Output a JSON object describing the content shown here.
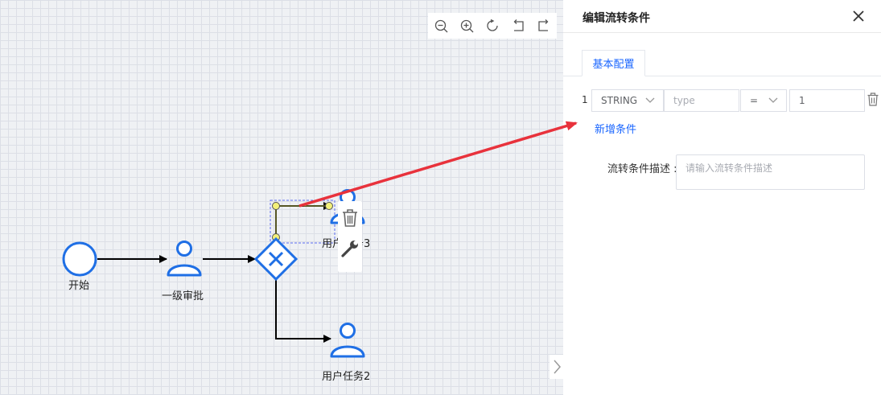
{
  "toolbar": {
    "items": [
      "zoom-out",
      "zoom-in",
      "reset",
      "undo",
      "redo"
    ]
  },
  "nodes": {
    "start_label": "开始",
    "approval_label": "一级审批",
    "task3_label": "用户任务3",
    "task2_label": "用户任务2"
  },
  "panel": {
    "title": "编辑流转条件",
    "tab_basic": "基本配置",
    "condition": {
      "index": "1",
      "type_value": "STRING",
      "field_placeholder": "type",
      "operator_value": "=",
      "compare_value": "1"
    },
    "add_condition": "新增条件",
    "description_label": "流转条件描述 :",
    "description_placeholder": "请输入流转条件描述"
  },
  "colors": {
    "accent": "#1a66ff",
    "node_blue": "#1f6fe5",
    "annotation_red": "#e8323c"
  }
}
